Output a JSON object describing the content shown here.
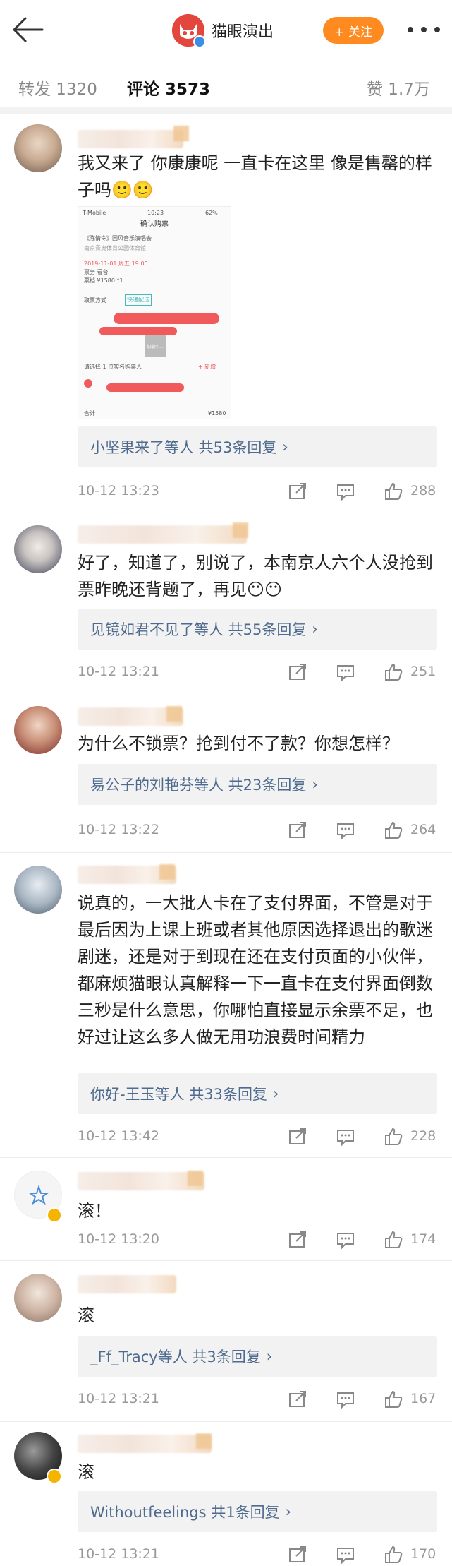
{
  "header": {
    "title": "猫眼演出",
    "follow_label": "+ 关注"
  },
  "tabs": [
    {
      "label": "转发 1320"
    },
    {
      "label": "评论 3573"
    },
    {
      "label": "赞 1.7万"
    }
  ],
  "comments": [
    {
      "text": "我又来了 你康康呢 一直卡在这里 像是售罄的样子吗🙂🙂",
      "screenshot": {
        "status_left": "T-Mobile",
        "status_time": "10:23",
        "status_right": "62%",
        "title": "确认购票",
        "event": "《陈情令》国风音乐演唱会",
        "venue": "南京青奥体育公园体育馆",
        "date": "2019-11-01 周五 19:00",
        "seat": "票务 看台",
        "price": "票档 ¥1580 *1",
        "delivery": "取票方式",
        "delivery_opt": "快递配送",
        "loading": "加载中...",
        "choose": "请选择 1 位实名购票人",
        "add": "+ 新增",
        "total_left": "合计",
        "total_right": "¥1580"
      },
      "replies": "小坚果来了等人  共53条回复",
      "time": "10-12 13:23",
      "likes": "288"
    },
    {
      "text": "好了，知道了，别说了，本南京人六个人没抢到票昨晚还背题了，再见😶😶",
      "replies": "见镜如君不见了等人  共55条回复",
      "time": "10-12 13:21",
      "likes": "251"
    },
    {
      "text": "为什么不锁票？抢到付不了款？你想怎样？",
      "replies": "易公子的刘艳芬等人  共23条回复",
      "time": "10-12 13:22",
      "likes": "264"
    },
    {
      "text": "说真的，一大批人卡在了支付界面，不管是对于最后因为上课上班或者其他原因选择退出的歌迷剧迷，还是对于到现在还在支付页面的小伙伴，都麻烦猫眼认真解释一下一直卡在支付界面倒数三秒是什么意思，你哪怕直接显示余票不足，也好过让这么多人做无用功浪费时间精力",
      "replies": "你好-王玉等人  共33条回复",
      "time": "10-12 13:42",
      "likes": "228"
    },
    {
      "text": "滚！",
      "time": "10-12 13:20",
      "likes": "174"
    },
    {
      "text": "滚",
      "replies": "_Ff_Tracy等人  共3条回复",
      "time": "10-12 13:21",
      "likes": "167"
    },
    {
      "text": "滚",
      "replies": "Withoutfeelings  共1条回复",
      "time": "10-12 13:21",
      "likes": "170"
    }
  ]
}
